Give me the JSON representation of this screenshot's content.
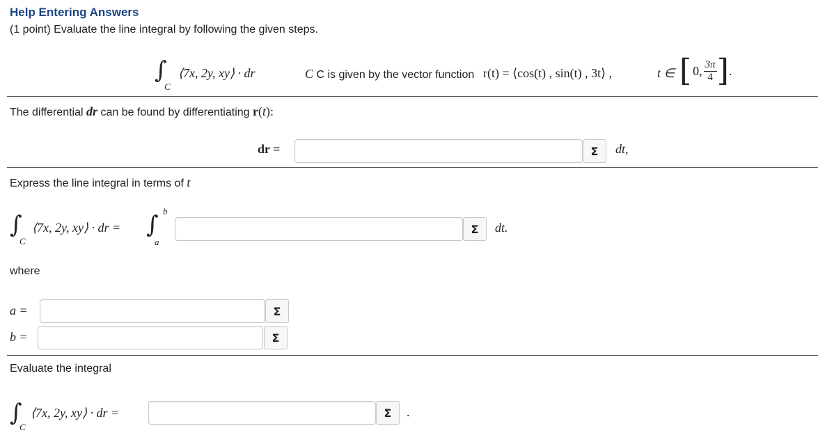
{
  "header": {
    "help_link": "Help Entering Answers",
    "problem_text": "(1 point) Evaluate the line integral by following the given steps."
  },
  "problem": {
    "integrand": "⟨7x, 2y, xy⟩ · dr",
    "integral_sub": "C",
    "curve_text": "C is given by the vector function",
    "r_of_t": "r(t) = ⟨cos(t) , sin(t) , 3t⟩ ,",
    "t_in": "t ∈",
    "interval_start": "0,",
    "interval_num": "3π",
    "interval_den": "4"
  },
  "step1": {
    "text": "The differential",
    "dr": "dr",
    "text2": "can be found by differentiating",
    "r_t": "r(t):",
    "lhs": "dr =",
    "value": "",
    "suffix": "dt,"
  },
  "step2": {
    "text": "Express the line integral in terms of",
    "t": "t",
    "lhs": "⟨7x, 2y, xy⟩ · dr =",
    "upper": "b",
    "lower": "a",
    "value": "",
    "suffix": "dt."
  },
  "limits": {
    "where_label": "where",
    "a_label": "a =",
    "a_value": "",
    "b_label": "b =",
    "b_value": ""
  },
  "step3": {
    "text": "Evaluate the integral",
    "lhs": "⟨7x, 2y, xy⟩ · dr =",
    "value": "",
    "suffix": "."
  },
  "sigma_symbol": "Σ"
}
